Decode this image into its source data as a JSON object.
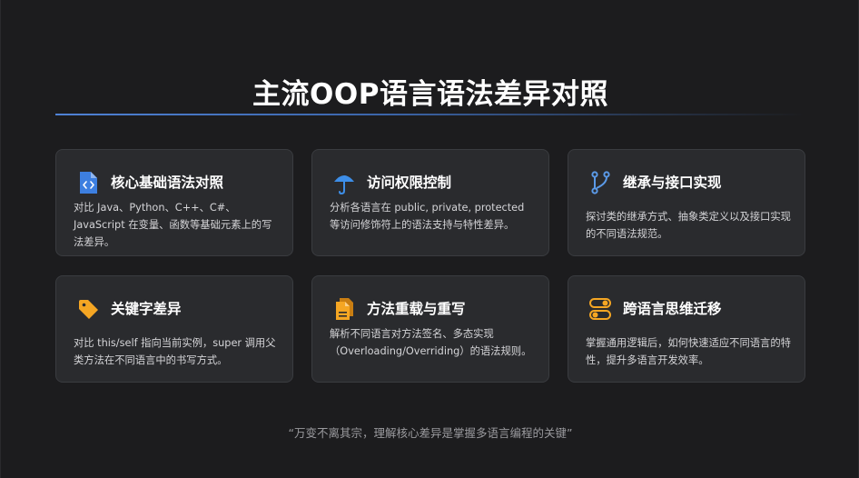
{
  "title": "主流OOP语言语法差异对照",
  "colors": {
    "background": "#1c1c1e",
    "card": "#2a2b2e",
    "accent_blue": "#3d7fe0",
    "accent_orange": "#f5a623"
  },
  "cards": [
    {
      "icon": "code-file-icon",
      "title": "核心基础语法对照",
      "description": "对比 Java、Python、C++、C#、JavaScript 在变量、函数等基础元素上的写法差异。"
    },
    {
      "icon": "umbrella-icon",
      "title": "访问权限控制",
      "description": "分析各语言在 public, private, protected 等访问修饰符上的语法支持与特性差异。"
    },
    {
      "icon": "branch-icon",
      "title": "继承与接口实现",
      "description": "探讨类的继承方式、抽象类定义以及接口实现的不同语法规范。"
    },
    {
      "icon": "tag-icon",
      "title": "关键字差异",
      "description": "对比 this/self 指向当前实例，super 调用父类方法在不同语言中的书写方式。"
    },
    {
      "icon": "document-icon",
      "title": "方法重载与重写",
      "description": "解析不同语言对方法签名、多态实现（Overloading/Overriding）的语法规则。"
    },
    {
      "icon": "toggle-icon",
      "title": "跨语言思维迁移",
      "description": "掌握通用逻辑后，如何快速适应不同语言的特性，提升多语言开发效率。"
    }
  ],
  "quote": "“万变不离其宗，理解核心差异是掌握多语言编程的关键”"
}
